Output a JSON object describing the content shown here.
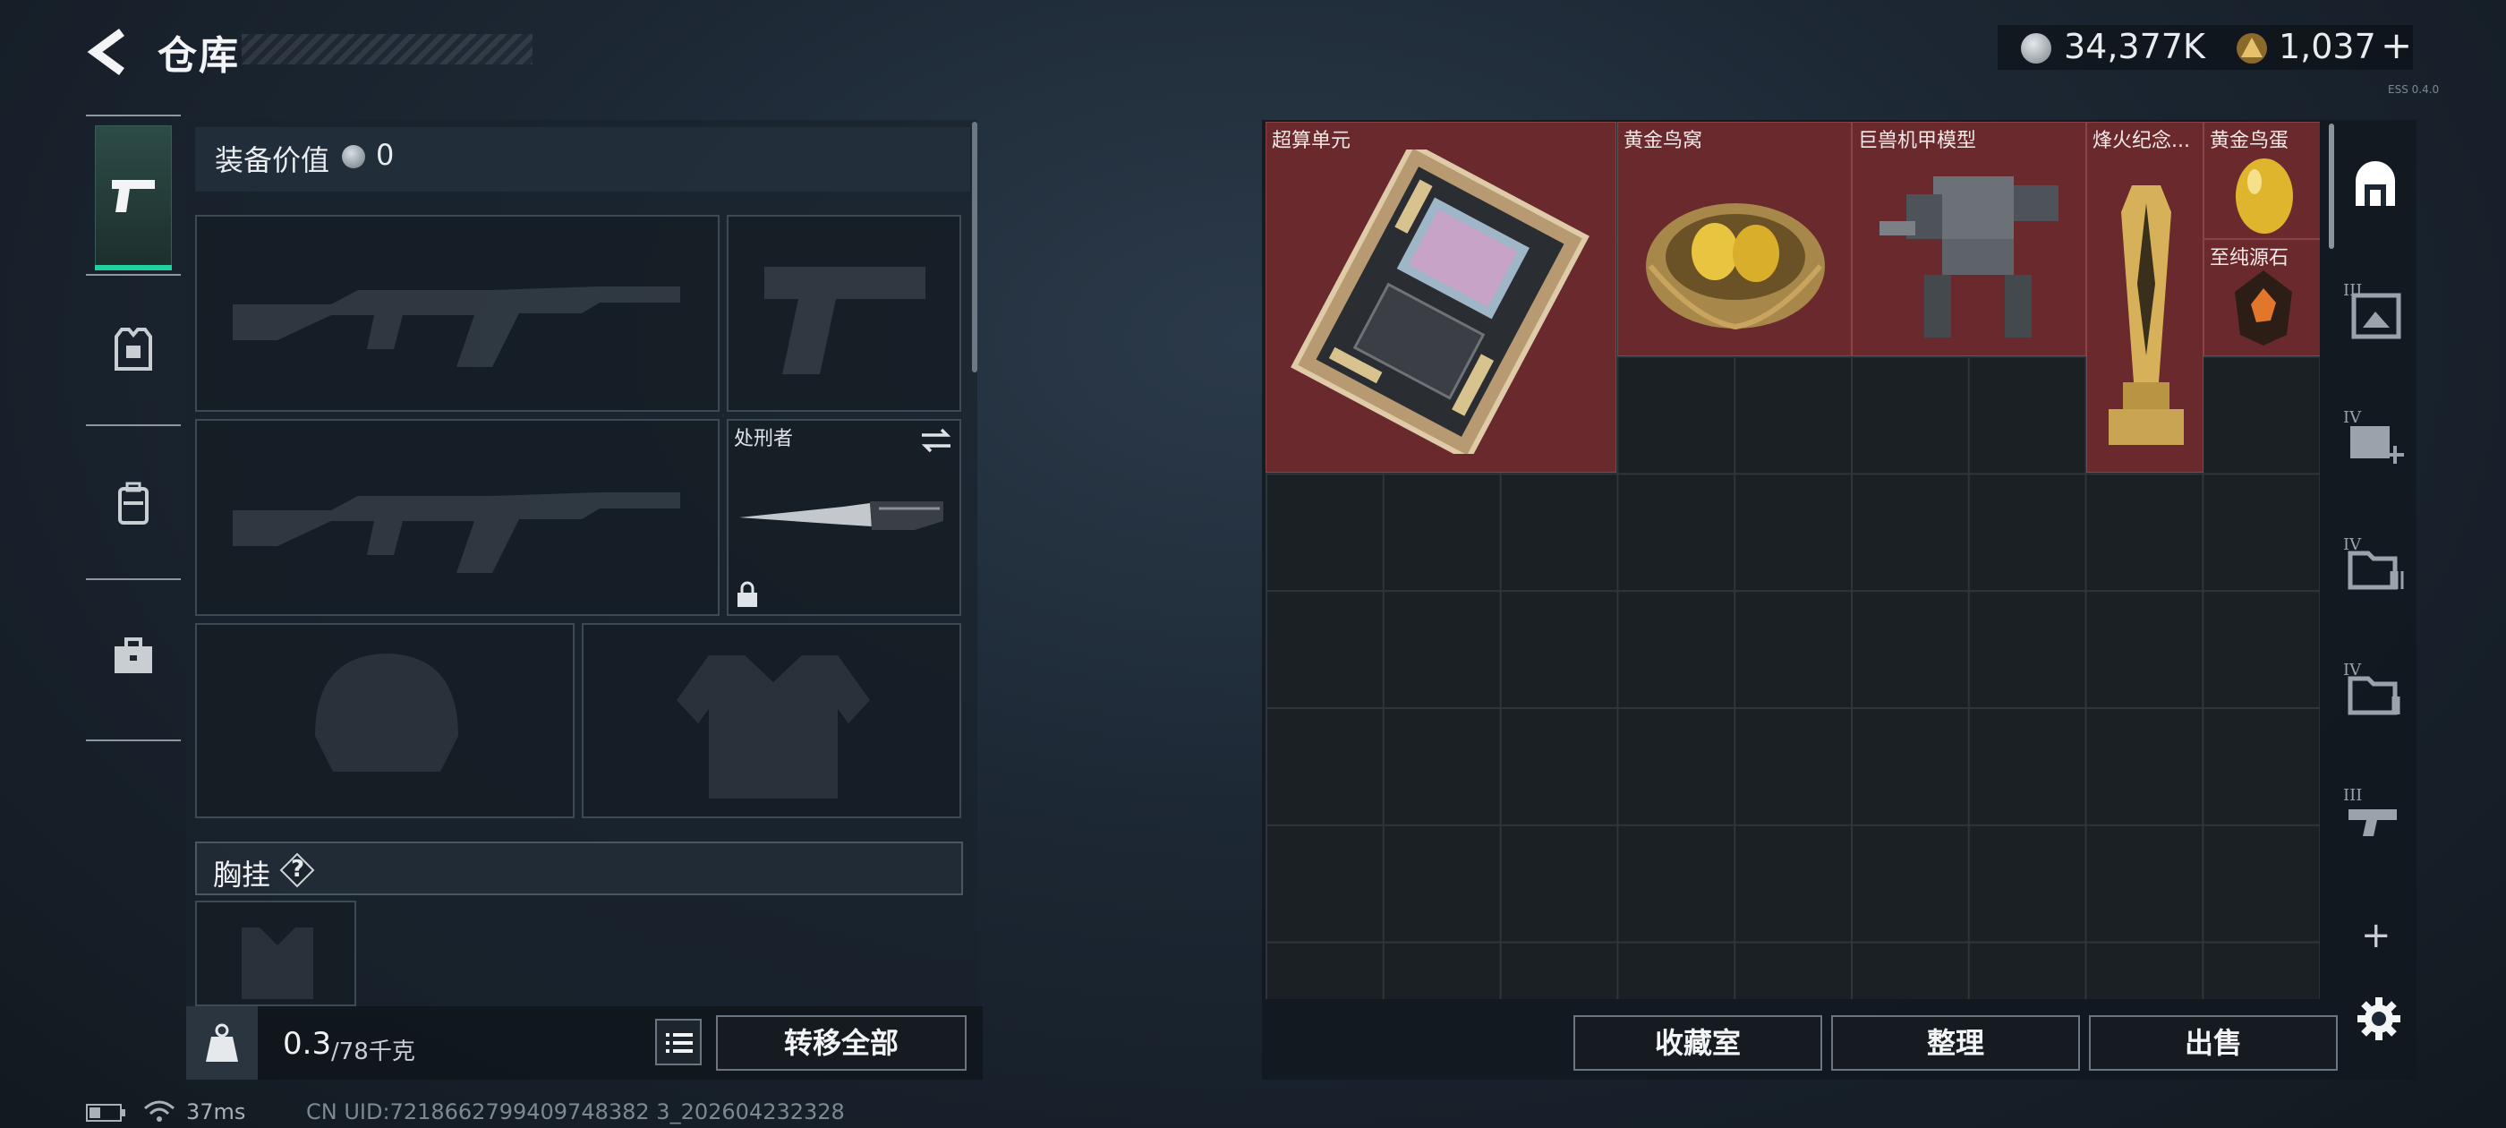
{
  "header": {
    "title": "仓库",
    "currency": [
      {
        "icon": "silver-coin-icon",
        "value": "34,377K"
      },
      {
        "icon": "gold-triangle-coin-icon",
        "value": "1,037"
      }
    ],
    "add_symbol": "+",
    "build_tag": "ESS 0.4.0"
  },
  "nav": {
    "items": [
      {
        "name": "weapons",
        "icon": "pistol-icon",
        "selected": true
      },
      {
        "name": "armor",
        "icon": "armor-vest-icon"
      },
      {
        "name": "backpack",
        "icon": "backpack-icon"
      },
      {
        "name": "items",
        "icon": "briefcase-icon"
      }
    ]
  },
  "equipment": {
    "value_label": "装备价值",
    "value": "0",
    "melee_name": "处刑者",
    "vest_label": "胸挂",
    "vest_help": "?",
    "weight_current": "0.3",
    "weight_max": "/78千克",
    "transfer_all": "转移全部"
  },
  "stash": {
    "items": [
      {
        "name": "超算单元"
      },
      {
        "name": "黄金鸟窝"
      },
      {
        "name": "巨兽机甲模型"
      },
      {
        "name": "烽火纪念..."
      },
      {
        "name": "黄金鸟蛋"
      },
      {
        "name": "至纯源石"
      }
    ],
    "buttons": {
      "collection": "收藏室",
      "sort": "整理",
      "sell": "出售"
    },
    "side_tabs": [
      {
        "icon": "case-all-icon",
        "selected": true
      },
      {
        "icon": "case-III-image-icon",
        "label": "III"
      },
      {
        "icon": "case-IV-plus-icon",
        "label": "IV"
      },
      {
        "icon": "case-IV-folder-icon",
        "label": "IV"
      },
      {
        "icon": "case-IV-folder-icon",
        "label": "IV"
      },
      {
        "icon": "case-III-gun-icon",
        "label": "III"
      },
      {
        "icon": "plus-icon",
        "label": "+"
      }
    ]
  },
  "status": {
    "ping": "37ms",
    "uid": "CN UID:7218662799409748382 3_202604232328"
  },
  "colors": {
    "accent": "#21d2a0",
    "item_bg": "#6a2a2d",
    "panel": "#19232d"
  }
}
